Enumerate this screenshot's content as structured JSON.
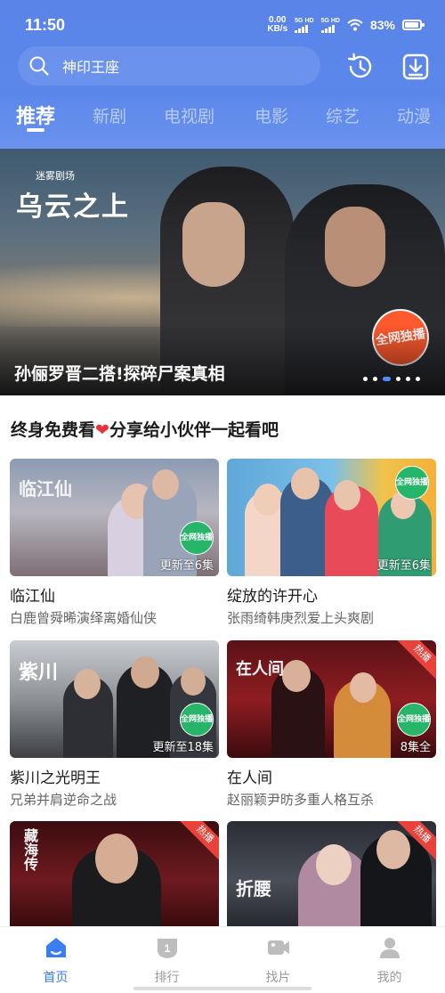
{
  "status_bar": {
    "time": "11:50",
    "net_speed_value": "0.00",
    "net_speed_unit": "KB/s",
    "sim1": "5G HD",
    "sim2": "5G HD",
    "battery": "83%"
  },
  "header": {
    "search_placeholder": "神印王座",
    "history_icon": "clock-history-icon",
    "download_icon": "download-icon"
  },
  "tabs": [
    {
      "label": "推荐",
      "active": true
    },
    {
      "label": "新剧",
      "active": false
    },
    {
      "label": "电视剧",
      "active": false
    },
    {
      "label": "电影",
      "active": false
    },
    {
      "label": "综艺",
      "active": false
    },
    {
      "label": "动漫",
      "active": false
    }
  ],
  "banner": {
    "brand": "迷雾剧场",
    "title_art": "乌云之上",
    "badge": "全网独播",
    "caption": "孙俪罗晋二搭!探碎尸案真相",
    "dot_count": 6,
    "active_dot": 2
  },
  "section": {
    "title_part1": "终身免费看",
    "heart": "❤",
    "title_part2": "分享给小伙伴一起看吧"
  },
  "cards": [
    {
      "name": "临江仙",
      "desc": "白鹿曾舜晞演绎离婚仙侠",
      "update": "更新至6集",
      "badge": "全网独播",
      "hot": "",
      "art": "临江仙"
    },
    {
      "name": "绽放的许开心",
      "desc": "张雨绮韩庚烈爱上头爽剧",
      "update": "更新至6集",
      "badge": "全网独播",
      "hot": "",
      "art": ""
    },
    {
      "name": "紫川之光明王",
      "desc": "兄弟并肩逆命之战",
      "update": "更新至18集",
      "badge": "全网独播",
      "hot": "",
      "art": "紫川"
    },
    {
      "name": "在人间",
      "desc": "赵丽颖尹昉多重人格互杀",
      "update": "8集全",
      "badge": "全网独播",
      "hot": "热播",
      "art": "在人间"
    },
    {
      "name": "",
      "desc": "",
      "update": "",
      "badge": "",
      "hot": "热播",
      "art": "藏海传"
    },
    {
      "name": "",
      "desc": "",
      "update": "",
      "badge": "",
      "hot": "热播",
      "art": "折腰"
    }
  ],
  "bottom_nav": [
    {
      "label": "首页",
      "icon": "home-icon",
      "active": true
    },
    {
      "label": "排行",
      "icon": "ranking-icon",
      "active": false
    },
    {
      "label": "找片",
      "icon": "video-camera-icon",
      "active": false
    },
    {
      "label": "我的",
      "icon": "profile-icon",
      "active": false
    }
  ],
  "colors": {
    "header_blue": "#5a84e8",
    "active_nav": "#3a7df0",
    "hot_red": "#e8423a",
    "exclusive_green": "#27b56a"
  }
}
